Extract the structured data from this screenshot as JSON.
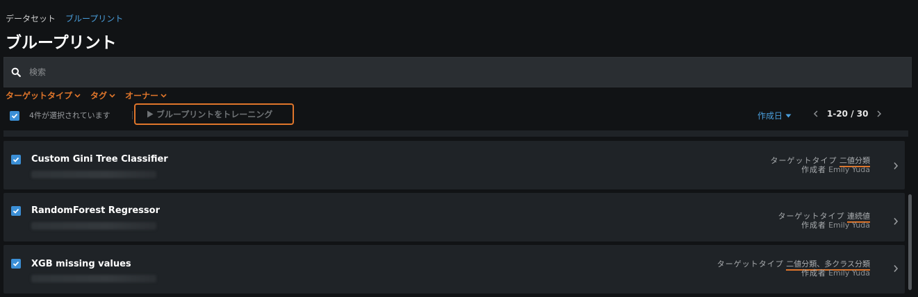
{
  "breadcrumb": {
    "items": [
      "データセット",
      "ブループリント"
    ]
  },
  "page_title": "ブループリント",
  "search": {
    "placeholder": "検索",
    "value": ""
  },
  "filters": [
    "ターゲットタイプ",
    "タグ",
    "オーナー"
  ],
  "selection": {
    "text": "4件が選択されています",
    "train_button": "ブループリントをトレーニング"
  },
  "sort": {
    "label": "作成日"
  },
  "pagination": {
    "text": "1-20 / 30"
  },
  "meta_labels": {
    "target_type": "ターゲットタイプ",
    "author": "作成者"
  },
  "blueprints": [
    {
      "name": "Custom Gini Tree Classifier",
      "target_type": "二値分類",
      "author": "Emily Yuda",
      "checked": true
    },
    {
      "name": "RandomForest Regressor",
      "target_type": "連続値",
      "author": "Emily Yuda",
      "checked": true
    },
    {
      "name": "XGB missing values",
      "target_type": "二値分類、多クラス分類",
      "author": "Emily Yuda",
      "checked": true
    }
  ],
  "colors": {
    "accent_orange": "#e0762b",
    "accent_blue": "#4a9fdd",
    "checkbox_blue": "#3b8fd6",
    "background": "#111315",
    "card": "#1f2327"
  }
}
